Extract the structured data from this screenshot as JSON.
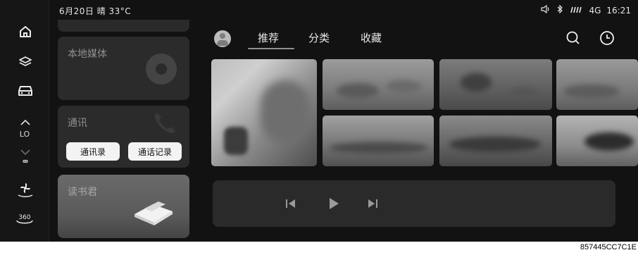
{
  "status": {
    "date_weather": "6月20日 晴 33°C",
    "network": "4G",
    "time": "16:21"
  },
  "rail": {
    "items": [
      {
        "icon": "home-icon"
      },
      {
        "icon": "layers-icon"
      },
      {
        "icon": "car-icon"
      },
      {
        "icon": "chevron-up-icon"
      },
      {
        "label": "LO"
      },
      {
        "icon": "chevron-down-icon"
      },
      {
        "icon": "fan-icon"
      },
      {
        "label": "360"
      }
    ]
  },
  "cards": {
    "media_title": "本地媒体",
    "comm_title": "通讯",
    "contacts_label": "通讯录",
    "call_log_label": "通话记录",
    "book_title": "读书君"
  },
  "main": {
    "tabs": [
      "推荐",
      "分类",
      "收藏"
    ],
    "active_tab": "推荐"
  },
  "caption": "857445CC7C1E"
}
